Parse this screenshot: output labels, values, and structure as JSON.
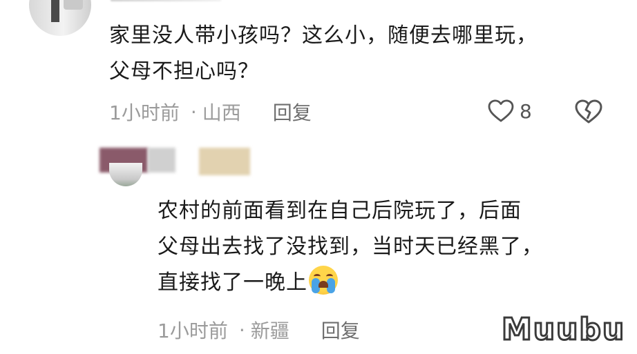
{
  "comments": [
    {
      "text": "家里没人带小孩吗？这么小，随便去哪里玩，\n父母不担心吗？",
      "time": "1小时前",
      "separator": "·",
      "location": "山西",
      "reply_label": "回复",
      "likes": "8"
    },
    {
      "text": "农村的前面看到在自己后院玩了，后面\n父母出去找了没找到，当时天已经黑了，\n直接找了一晚上",
      "time": "1小时前",
      "separator": "·",
      "location": "新疆",
      "reply_label": "回复"
    }
  ],
  "watermark": "Muubu",
  "icons": {
    "like": "heart-outline-icon",
    "dislike": "broken-heart-icon",
    "emoji": "crying-face-emoji"
  },
  "colors": {
    "text": "#1a1a1a",
    "meta": "#9b9b9b"
  }
}
